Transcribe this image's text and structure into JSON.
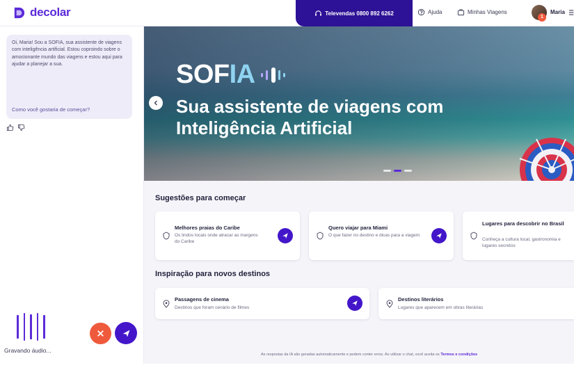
{
  "header": {
    "logo_text": "decolar",
    "phone_label": "Televendas 0800 892 6262",
    "help_label": "Ajuda",
    "trips_label": "Minhas Viagens",
    "user_name": "Maria",
    "notification_count": "1",
    "brand_color": "#5b2ad8",
    "phone_bg_color": "#2d1196"
  },
  "chat": {
    "greeting": "Oi, Maria! Sou a SOFIA, sua assistente de viagens com inteligência artificial. Estou coproindo sobre o amocionante mundo das viagens e estou aqui para ajudar a planejar a sua.",
    "question": "Como você gostaria de começar?",
    "recording_label": "Gravando áudio...",
    "icons": [
      "thumbs-up-icon",
      "thumbs-down-icon",
      "close-icon",
      "send-icon"
    ]
  },
  "hero": {
    "brand_sof": "SOF",
    "brand_ia": "IA",
    "title": "Sua assistente de viagens com Inteligência Artificial",
    "active_slide": 2,
    "slide_count": 3
  },
  "suggestions": {
    "title": "Sugestões para começar",
    "cards": [
      {
        "title": "Melhores praias do Caribe",
        "subtitle": "Os lindos locais onde atracar as margens do Caribe"
      },
      {
        "title": "Quero viajar para Miami",
        "subtitle": "O que fazer no destino e dicas para a viagem"
      },
      {
        "title": "Lugares para descobrir no Brasil",
        "subtitle": "Conheça a cultura local, gastronomia e lugares secretos"
      }
    ]
  },
  "inspiration": {
    "title": "Inspiração para novos destinos",
    "cards": [
      {
        "title": "Passagens de cinema",
        "subtitle": "Destinos que foram cenário de filmes"
      },
      {
        "title": "Destinos literários",
        "subtitle": "Lugares que aparecem em obras literárias"
      }
    ]
  },
  "footer": {
    "disclaimer": "As respostas da IA são geradas automaticamente e podem conter erros. Ao utilizar o chat, você aceita os",
    "terms_link": "Termos e condições"
  }
}
